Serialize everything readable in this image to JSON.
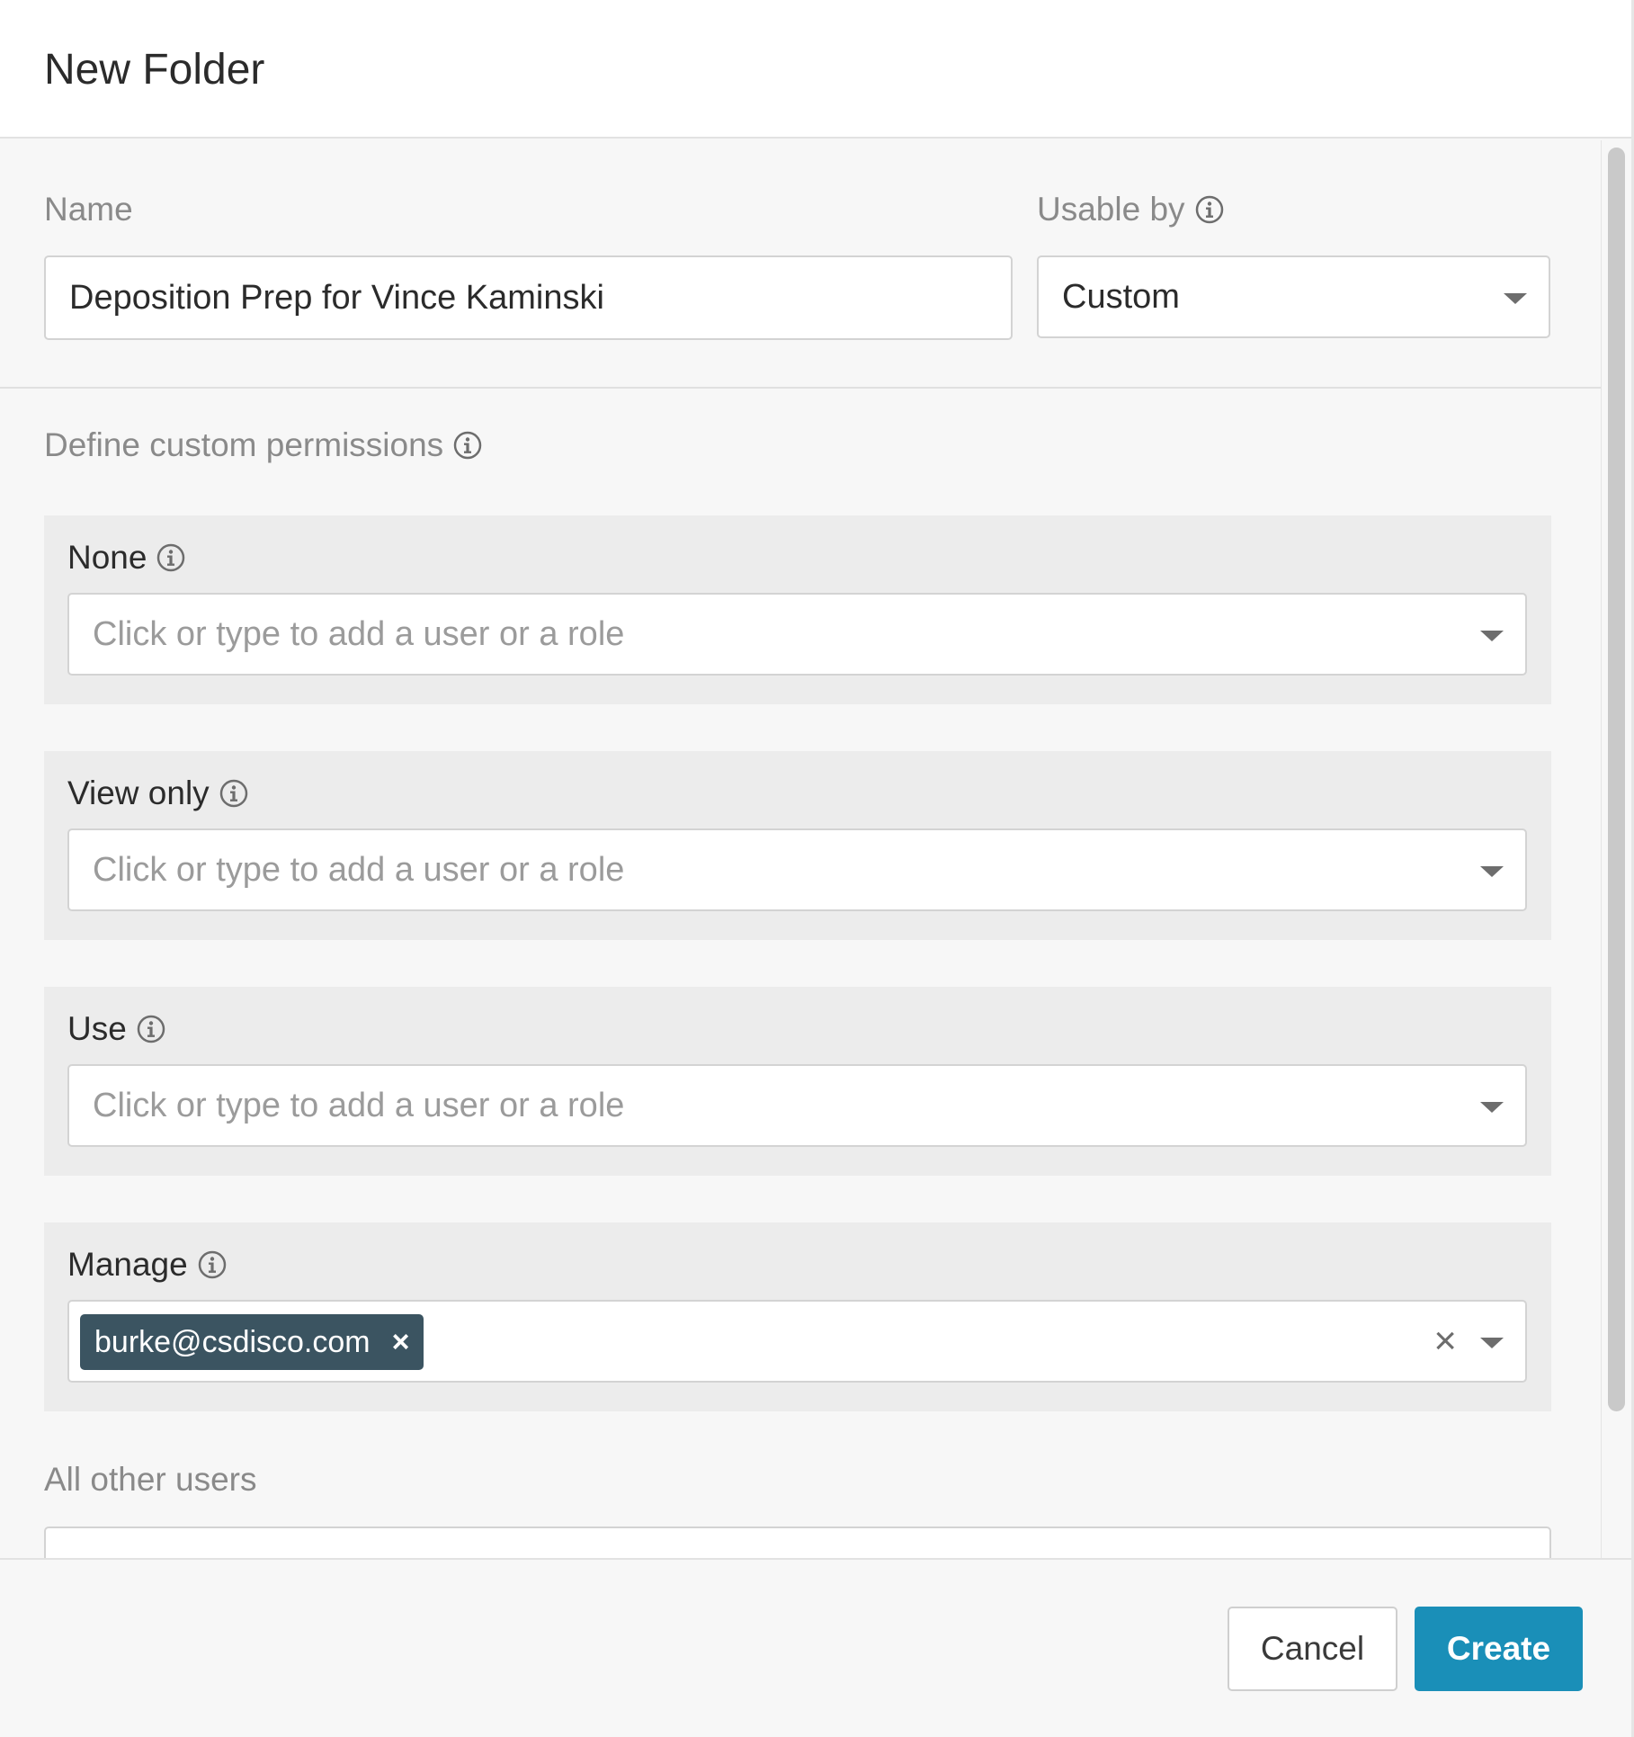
{
  "dialog": {
    "title": "New Folder"
  },
  "form": {
    "name_label": "Name",
    "name_value": "Deposition Prep for Vince Kaminski",
    "usable_by_label": "Usable by",
    "usable_by_value": "Custom",
    "custom_permissions_label": "Define custom permissions",
    "permissions": [
      {
        "label": "None",
        "placeholder": "Click or type to add a user or a role"
      },
      {
        "label": "View only",
        "placeholder": "Click or type to add a user or a role"
      },
      {
        "label": "Use",
        "placeholder": "Click or type to add a user or a role"
      },
      {
        "label": "Manage",
        "tags": [
          "burke@csdisco.com"
        ],
        "tag_remove": "×",
        "clear": "×"
      }
    ],
    "all_other_users_label": "All other users"
  },
  "footer": {
    "cancel_label": "Cancel",
    "create_label": "Create"
  },
  "colors": {
    "primary": "#1a8fb8",
    "tag_bg": "#3b5461",
    "panel_bg": "#ececec"
  },
  "icons": [
    "info-icon",
    "chevron-down-icon",
    "close-icon"
  ]
}
